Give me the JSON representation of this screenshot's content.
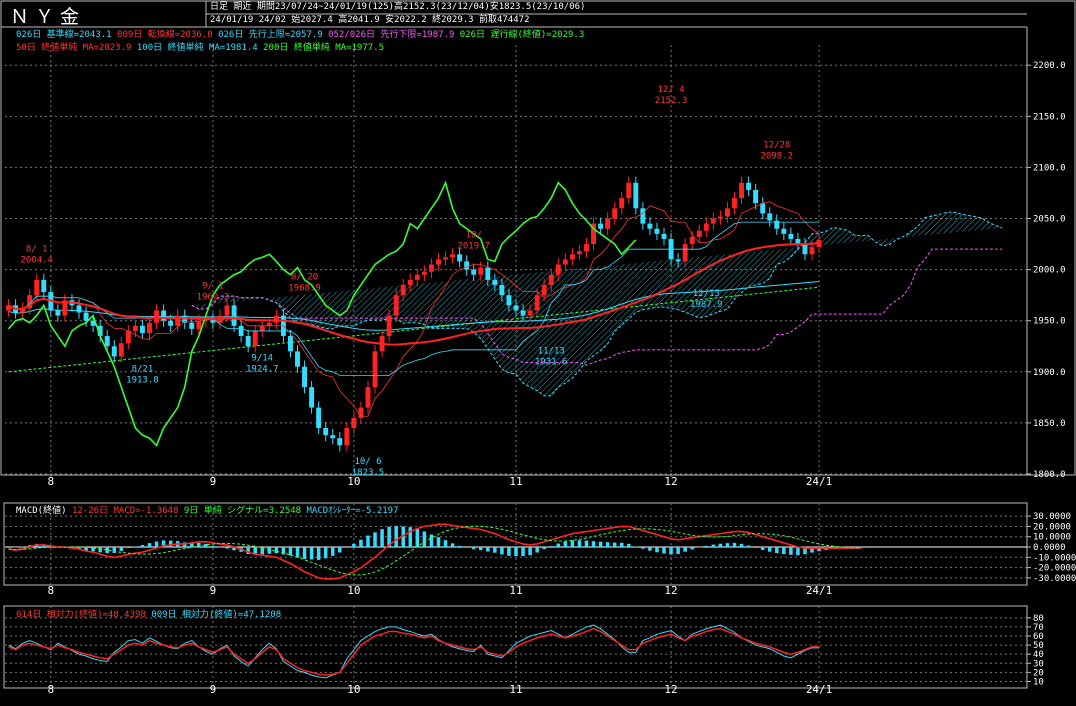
{
  "window": {
    "title": "ＮＹ金"
  },
  "header": {
    "line1_label": "日足 期近",
    "line1": "期間23/07/24~24/01/19(125)高2152.3(23/12/04)安1823.5(23/10/06)",
    "line2": "24/01/19 24/02 始2027.4 高2041.9 安2022.2 終2029.3 前取474472"
  },
  "legend": {
    "row1": [
      {
        "text": "026日 基準線=2043.1",
        "color": "#33ddff"
      },
      {
        "text": "009日 転換線=2036.0",
        "color": "#ff3333"
      },
      {
        "text": "026日 先行上限=2057.9",
        "color": "#33ddff"
      },
      {
        "text": "052/026日 先行下限=1987.9",
        "color": "#ff55ff"
      },
      {
        "text": "026日 遅行線(終値)=2029.3",
        "color": "#33ff33"
      }
    ],
    "row2": [
      {
        "text": "50日 終値単純 MA=2023.9",
        "color": "#ff3333"
      },
      {
        "text": "100日 終値単純 MA=1981.4",
        "color": "#33ddff"
      },
      {
        "text": "200日 終値単純 MA=1977.5",
        "color": "#33ff33"
      }
    ]
  },
  "macd_legend": [
    {
      "text": "MACD(終値)",
      "color": "#ffffff"
    },
    {
      "text": "12-26日 MACD=-1.3648",
      "color": "#ff3333"
    },
    {
      "text": "9日 単純 シグナル=3.2548",
      "color": "#33ff33"
    },
    {
      "text": "MACDｵｼﾚｰﾀｰ=-5.2197",
      "color": "#33ddff"
    }
  ],
  "rsi_legend": [
    {
      "text": "014日 相対力(終値)=48.4398",
      "color": "#ff3333"
    },
    {
      "text": "009日 相対力(終値)=47.1208",
      "color": "#33ddff"
    }
  ],
  "x_axis_labels": [
    {
      "label": "8",
      "day": 6
    },
    {
      "label": "9",
      "day": 29
    },
    {
      "label": "10",
      "day": 49
    },
    {
      "label": "11",
      "day": 72
    },
    {
      "label": "12",
      "day": 94
    },
    {
      "label": "24/1",
      "day": 115
    }
  ],
  "chart_data": [
    {
      "type": "candlestick",
      "y_ticks": [
        1800,
        1850,
        1900,
        1950,
        2000,
        2050,
        2100,
        2150,
        2200
      ],
      "ylim": [
        1800,
        2210
      ],
      "n_days": 125,
      "closes": [
        1965,
        1958,
        1962,
        1975,
        1990,
        1978,
        1960,
        1955,
        1970,
        1965,
        1958,
        1950,
        1945,
        1935,
        1925,
        1915,
        1928,
        1940,
        1945,
        1938,
        1948,
        1960,
        1950,
        1945,
        1955,
        1948,
        1942,
        1950,
        1952,
        1948,
        1955,
        1965,
        1945,
        1935,
        1925,
        1940,
        1945,
        1948,
        1955,
        1935,
        1920,
        1905,
        1885,
        1865,
        1845,
        1838,
        1835,
        1828,
        1845,
        1855,
        1865,
        1885,
        1920,
        1935,
        1955,
        1975,
        1985,
        1990,
        1995,
        1998,
        2005,
        2010,
        2012,
        2015,
        2008,
        2000,
        1995,
        2002,
        1990,
        1985,
        1975,
        1965,
        1960,
        1955,
        1960,
        1975,
        1985,
        1995,
        2005,
        2010,
        2015,
        2018,
        2025,
        2045,
        2040,
        2050,
        2060,
        2070,
        2085,
        2060,
        2045,
        2040,
        2035,
        2030,
        2010,
        2008,
        2025,
        2032,
        2038,
        2045,
        2050,
        2052,
        2060,
        2070,
        2085,
        2078,
        2065,
        2055,
        2048,
        2040,
        2035,
        2030,
        2025,
        2015,
        2022,
        2029
      ],
      "annotations": [
        {
          "day": 4,
          "price": 1996.4,
          "text": "8/ 1\n2004.4",
          "color": "#ff3333",
          "pos": "above"
        },
        {
          "day": 19,
          "price": 1913.8,
          "text": "8/21\n1913.8",
          "color": "#33ddff",
          "pos": "below"
        },
        {
          "day": 29,
          "price": 1960.2,
          "text": "9/ 1\n1960.2",
          "color": "#ff3333",
          "pos": "above"
        },
        {
          "day": 36,
          "price": 1924.7,
          "text": "9/14\n1924.7",
          "color": "#33ddff",
          "pos": "below"
        },
        {
          "day": 42,
          "price": 1968.9,
          "text": "8/ 20\n1968.9",
          "color": "#ff3333",
          "pos": "above"
        },
        {
          "day": 51,
          "price": 1823.5,
          "text": "10/ 6\n1823.5",
          "color": "#33ddff",
          "pos": "below"
        },
        {
          "day": 66,
          "price": 2009.7,
          "text": "10/\n2019.7",
          "color": "#ff3333",
          "pos": "above"
        },
        {
          "day": 77,
          "price": 1931.6,
          "text": "11/13\n1931.6",
          "color": "#33ddff",
          "pos": "below"
        },
        {
          "day": 94,
          "price": 2152.3,
          "text": "12/ 4\n2152.3",
          "color": "#ff3333",
          "pos": "above"
        },
        {
          "day": 99,
          "price": 1987.9,
          "text": "12/13\n1987.9",
          "color": "#33ddff",
          "pos": "below"
        },
        {
          "day": 109,
          "price": 2098.2,
          "text": "12/28\n2098.2",
          "color": "#ff3333",
          "pos": "above"
        }
      ]
    },
    {
      "type": "macd",
      "y_ticks": [
        30,
        20,
        10,
        0,
        -10,
        -20,
        -30
      ],
      "ylim": [
        -33,
        33
      ],
      "macd": [
        -2,
        -3,
        -2,
        0,
        2,
        2,
        1,
        0,
        0,
        -1,
        -2,
        -4,
        -5,
        -7,
        -9,
        -10,
        -9,
        -7,
        -6,
        -5,
        -3,
        -1,
        1,
        2,
        3,
        3,
        4,
        5,
        5,
        4,
        3,
        2,
        0,
        -2,
        -5,
        -7,
        -8,
        -9,
        -10,
        -13,
        -16,
        -20,
        -24,
        -27,
        -30,
        -31,
        -31,
        -30,
        -27,
        -24,
        -20,
        -15,
        -10,
        -4,
        2,
        7,
        11,
        15,
        18,
        20,
        21,
        22,
        22,
        21,
        20,
        19,
        18,
        17,
        15,
        13,
        10,
        7,
        5,
        3,
        2,
        3,
        5,
        7,
        9,
        11,
        13,
        14,
        15,
        16,
        17,
        18,
        19,
        20,
        20,
        18,
        16,
        14,
        12,
        10,
        8,
        7,
        8,
        9,
        10,
        11,
        12,
        13,
        14,
        15,
        15,
        14,
        12,
        10,
        8,
        6,
        4,
        2,
        0,
        -1,
        -1,
        -1,
        -1,
        -1,
        -1,
        -1,
        -1,
        -1
      ]
    },
    {
      "type": "rsi",
      "y_ticks": [
        80,
        70,
        60,
        50,
        40,
        30,
        20,
        10
      ],
      "ylim": [
        5,
        82
      ],
      "rsi14": [
        48,
        45,
        50,
        52,
        50,
        48,
        46,
        50,
        47,
        45,
        42,
        40,
        38,
        36,
        35,
        40,
        45,
        50,
        52,
        50,
        55,
        52,
        50,
        48,
        47,
        50,
        52,
        48,
        45,
        42,
        45,
        48,
        40,
        35,
        30,
        35,
        42,
        48,
        45,
        35,
        30,
        25,
        22,
        20,
        18,
        17,
        18,
        20,
        30,
        40,
        50,
        55,
        60,
        62,
        65,
        65,
        63,
        62,
        60,
        58,
        60,
        55,
        52,
        50,
        48,
        46,
        45,
        48,
        42,
        40,
        38,
        42,
        48,
        52,
        55,
        58,
        60,
        62,
        60,
        58,
        60,
        62,
        65,
        68,
        65,
        60,
        55,
        50,
        45,
        45,
        52,
        55,
        58,
        60,
        62,
        58,
        55,
        60,
        62,
        65,
        67,
        68,
        65,
        62,
        58,
        55,
        52,
        50,
        48,
        45,
        42,
        40,
        42,
        45,
        48,
        48
      ],
      "rsi9": [
        50,
        46,
        52,
        55,
        52,
        48,
        45,
        52,
        48,
        44,
        40,
        38,
        35,
        33,
        32,
        42,
        48,
        55,
        56,
        52,
        58,
        54,
        50,
        47,
        46,
        52,
        55,
        48,
        43,
        40,
        46,
        50,
        38,
        32,
        27,
        36,
        45,
        52,
        46,
        32,
        27,
        22,
        20,
        17,
        15,
        14,
        17,
        20,
        35,
        45,
        55,
        60,
        65,
        68,
        70,
        70,
        67,
        65,
        62,
        60,
        62,
        56,
        52,
        48,
        46,
        44,
        43,
        50,
        40,
        38,
        36,
        44,
        52,
        56,
        60,
        62,
        64,
        66,
        62,
        58,
        62,
        66,
        70,
        72,
        68,
        62,
        56,
        48,
        42,
        42,
        55,
        58,
        62,
        64,
        66,
        60,
        55,
        62,
        65,
        68,
        70,
        72,
        68,
        64,
        58,
        54,
        50,
        48,
        46,
        42,
        38,
        36,
        40,
        44,
        47,
        47
      ]
    }
  ]
}
